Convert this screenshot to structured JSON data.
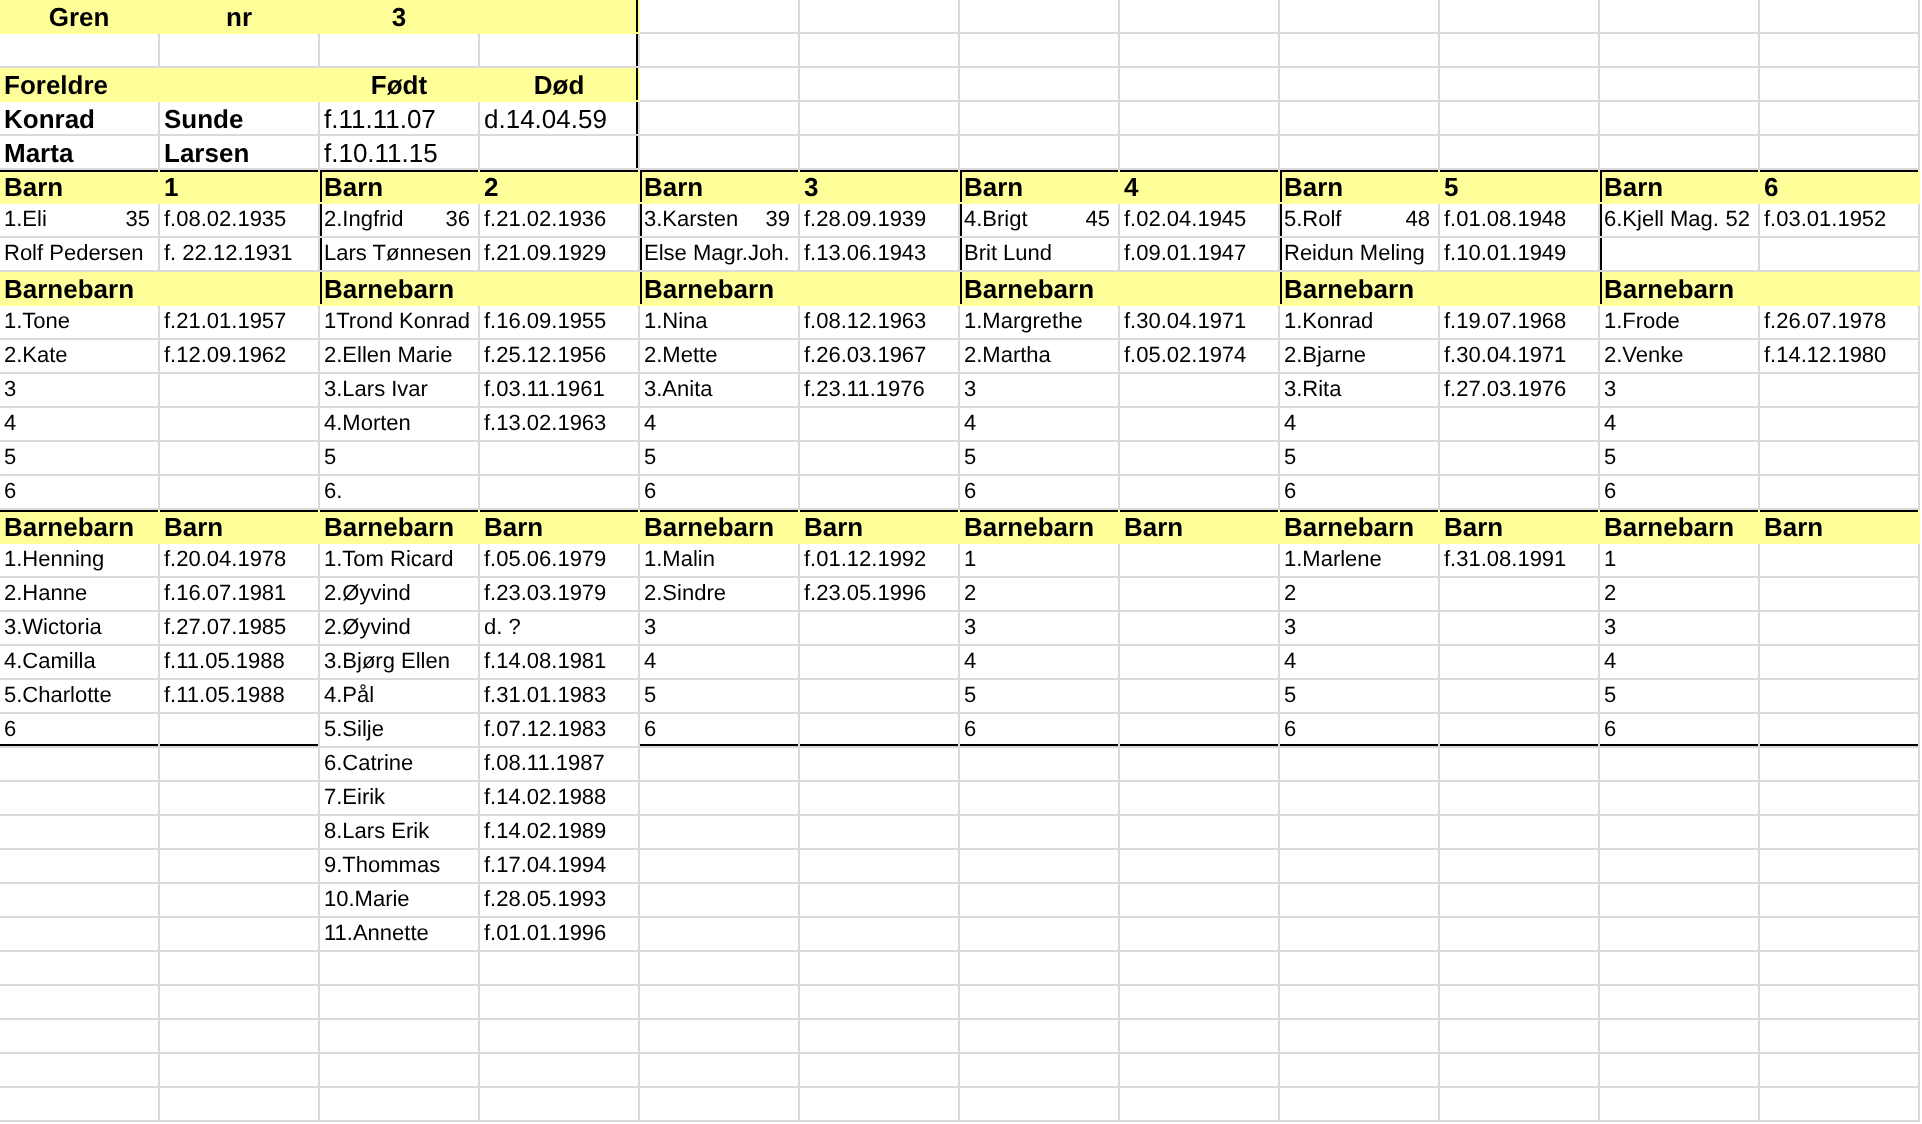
{
  "header": {
    "label": "Gren",
    "nr_label": "nr",
    "nr": "3"
  },
  "parents": {
    "heading": "Foreldre",
    "born_heading": "Født",
    "died_heading": "Død",
    "rows": [
      {
        "first": "Konrad",
        "last": "Sunde",
        "born": "f.11.11.07",
        "died": "d.14.04.59"
      },
      {
        "first": "Marta",
        "last": "Larsen",
        "born": "f.10.11.15"
      }
    ]
  },
  "children": [
    {
      "heading": "Barn",
      "number": "1",
      "name": "1.Eli",
      "age": "35",
      "born": "f.08.02.1935",
      "spouse": "Rolf Pedersen",
      "spouse_born": "f. 22.12.1931",
      "grandchildren_heading": "Barnebarn",
      "grandchildren": [
        {
          "name": "1.Tone",
          "born": "f.21.01.1957"
        },
        {
          "name": "2.Kate",
          "born": "f.12.09.1962"
        },
        {
          "name": "3"
        },
        {
          "name": "4"
        },
        {
          "name": "5"
        },
        {
          "name": "6"
        }
      ]
    },
    {
      "heading": "Barn",
      "number": "2",
      "name": "2.Ingfrid",
      "age": "36",
      "born": "f.21.02.1936",
      "spouse": "Lars Tønnesen",
      "spouse_born": "f.21.09.1929",
      "grandchildren_heading": "Barnebarn",
      "grandchildren": [
        {
          "name": "1Trond Konrad",
          "born": "f.16.09.1955"
        },
        {
          "name": "2.Ellen Marie",
          "born": "f.25.12.1956"
        },
        {
          "name": "3.Lars Ivar",
          "born": "f.03.11.1961"
        },
        {
          "name": "4.Morten",
          "born": "f.13.02.1963"
        },
        {
          "name": "5"
        },
        {
          "name": "6."
        }
      ]
    },
    {
      "heading": "Barn",
      "number": "3",
      "name": "3.Karsten",
      "age": "39",
      "born": "f.28.09.1939",
      "spouse": "Else Magr.Joh.",
      "spouse_born": "f.13.06.1943",
      "grandchildren_heading": "Barnebarn",
      "grandchildren": [
        {
          "name": "1.Nina",
          "born": "f.08.12.1963"
        },
        {
          "name": "2.Mette",
          "born": "f.26.03.1967"
        },
        {
          "name": "3.Anita",
          "born": "f.23.11.1976"
        },
        {
          "name": "4"
        },
        {
          "name": "5"
        },
        {
          "name": "6"
        }
      ]
    },
    {
      "heading": "Barn",
      "number": "4",
      "name": "4.Brigt",
      "age": "45",
      "born": "f.02.04.1945",
      "spouse": "Brit Lund",
      "spouse_born": "f.09.01.1947",
      "grandchildren_heading": "Barnebarn",
      "grandchildren": [
        {
          "name": "1.Margrethe",
          "born": "f.30.04.1971"
        },
        {
          "name": "2.Martha",
          "born": "f.05.02.1974"
        },
        {
          "name": "3"
        },
        {
          "name": "4"
        },
        {
          "name": "5"
        },
        {
          "name": "6"
        }
      ]
    },
    {
      "heading": "Barn",
      "number": "5",
      "name": "5.Rolf",
      "age": "48",
      "born": "f.01.08.1948",
      "spouse": "Reidun Meling",
      "spouse_born": "f.10.01.1949",
      "grandchildren_heading": "Barnebarn",
      "grandchildren": [
        {
          "name": "1.Konrad",
          "born": "f.19.07.1968"
        },
        {
          "name": "2.Bjarne",
          "born": "f.30.04.1971"
        },
        {
          "name": "3.Rita",
          "born": "f.27.03.1976"
        },
        {
          "name": "4"
        },
        {
          "name": "5"
        },
        {
          "name": "6"
        }
      ]
    },
    {
      "heading": "Barn",
      "number": "6",
      "name": "6.Kjell Mag.",
      "age": "52",
      "born": "f.03.01.1952",
      "grandchildren_heading": "Barnebarn",
      "grandchildren": [
        {
          "name": "1.Frode",
          "born": "f.26.07.1978"
        },
        {
          "name": "2.Venke",
          "born": "f.14.12.1980"
        },
        {
          "name": "3"
        },
        {
          "name": "4"
        },
        {
          "name": "5"
        },
        {
          "name": "6"
        }
      ]
    }
  ],
  "great_grandchildren": [
    {
      "name_heading": "Barnebarn",
      "born_heading": "Barn",
      "rows": [
        {
          "name": "1.Henning",
          "born": "f.20.04.1978"
        },
        {
          "name": "2.Hanne",
          "born": "f.16.07.1981"
        },
        {
          "name": "3.Wictoria",
          "born": "f.27.07.1985"
        },
        {
          "name": "4.Camilla",
          "born": "f.11.05.1988"
        },
        {
          "name": "5.Charlotte",
          "born": "f.11.05.1988"
        },
        {
          "name": "6"
        }
      ]
    },
    {
      "name_heading": "Barnebarn",
      "born_heading": "Barn",
      "rows": [
        {
          "name": "1.Tom Ricard",
          "born": "f.05.06.1979"
        },
        {
          "name": "2.Øyvind",
          "born": "f.23.03.1979"
        },
        {
          "name": "2.Øyvind",
          "born": "d. ?"
        },
        {
          "name": "3.Bjørg Ellen",
          "born": "f.14.08.1981"
        },
        {
          "name": "4.Pål",
          "born": "f.31.01.1983"
        },
        {
          "name": "5.Silje",
          "born": "f.07.12.1983"
        },
        {
          "name": "6.Catrine",
          "born": "f.08.11.1987"
        },
        {
          "name": "7.Eirik",
          "born": "f.14.02.1988"
        },
        {
          "name": "8.Lars Erik",
          "born": "f.14.02.1989"
        },
        {
          "name": "9.Thommas",
          "born": "f.17.04.1994"
        },
        {
          "name": "10.Marie",
          "born": "f.28.05.1993"
        },
        {
          "name": "11.Annette",
          "born": "f.01.01.1996"
        }
      ]
    },
    {
      "name_heading": "Barnebarn",
      "born_heading": "Barn",
      "rows": [
        {
          "name": "1.Malin",
          "born": "f.01.12.1992"
        },
        {
          "name": "2.Sindre",
          "born": "f.23.05.1996"
        },
        {
          "name": "3"
        },
        {
          "name": "4"
        },
        {
          "name": "5"
        },
        {
          "name": "6"
        }
      ]
    },
    {
      "name_heading": "Barnebarn",
      "born_heading": "Barn",
      "rows": [
        {
          "name": "1"
        },
        {
          "name": "2"
        },
        {
          "name": "3"
        },
        {
          "name": "4"
        },
        {
          "name": "5"
        },
        {
          "name": "6"
        }
      ]
    },
    {
      "name_heading": "Barnebarn",
      "born_heading": "Barn",
      "rows": [
        {
          "name": "1.Marlene",
          "born": "f.31.08.1991"
        },
        {
          "name": "2"
        },
        {
          "name": "3"
        },
        {
          "name": "4"
        },
        {
          "name": "5"
        },
        {
          "name": "6"
        }
      ]
    },
    {
      "name_heading": "Barnebarn",
      "born_heading": "Barn",
      "rows": [
        {
          "name": "1"
        },
        {
          "name": "2"
        },
        {
          "name": "3"
        },
        {
          "name": "4"
        },
        {
          "name": "5"
        },
        {
          "name": "6"
        }
      ]
    }
  ]
}
